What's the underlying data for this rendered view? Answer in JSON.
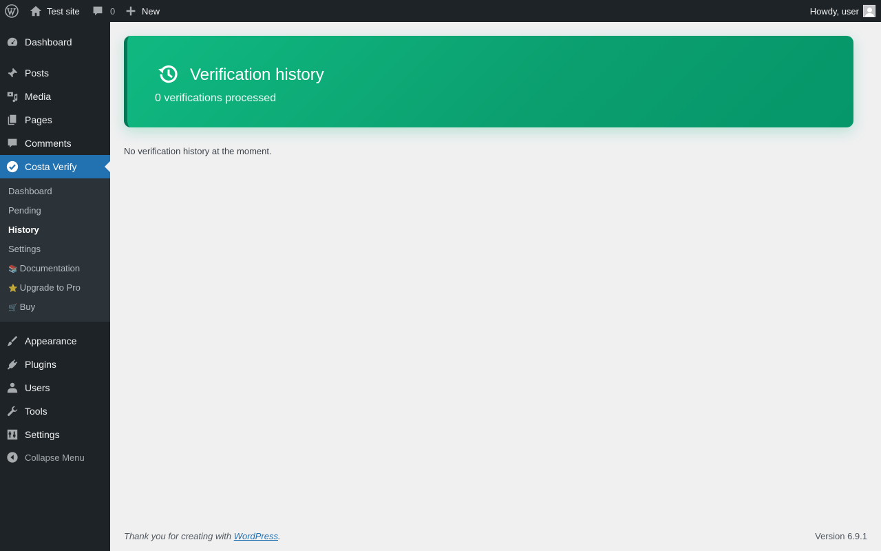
{
  "adminbar": {
    "site_name": "Test site",
    "comments_count": "0",
    "new_label": "New",
    "howdy": "Howdy, user"
  },
  "menu": {
    "dashboard": "Dashboard",
    "posts": "Posts",
    "media": "Media",
    "pages": "Pages",
    "comments": "Comments",
    "costa_verify": "Costa Verify",
    "appearance": "Appearance",
    "plugins": "Plugins",
    "users": "Users",
    "tools": "Tools",
    "settings": "Settings",
    "collapse": "Collapse Menu"
  },
  "submenu": {
    "dashboard": "Dashboard",
    "pending": "Pending",
    "history": "History",
    "settings": "Settings",
    "documentation": "Documentation",
    "documentation_emoji": "📚",
    "upgrade": "Upgrade to Pro",
    "upgrade_emoji": "⭐",
    "buy": "Buy",
    "buy_emoji": "🛒"
  },
  "hero": {
    "title": "Verification history",
    "subtitle": "0 verifications processed"
  },
  "empty_message": "No verification history at the moment.",
  "footer": {
    "thanks_prefix": "Thank you for creating with ",
    "thanks_link": "WordPress",
    "thanks_suffix": ".",
    "version": "Version 6.9.1"
  },
  "colors": {
    "admin_dark": "#1d2327",
    "accent_blue": "#2271b1",
    "hero_green": "#10b981"
  }
}
